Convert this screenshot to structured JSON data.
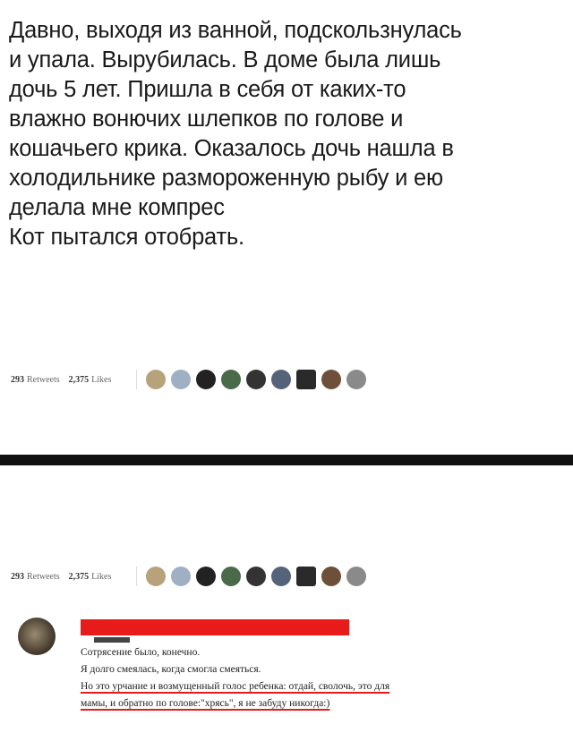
{
  "post": {
    "lines": [
      "Давно, выходя из ванной, подскользнулась",
      "и упала. Вырубилась. В доме была лишь",
      "дочь 5 лет. Пришла в себя от каких-то",
      "влажно вонючих шлепков по голове и",
      "кошачьего крика. Оказалось дочь нашла в",
      "холодильнике размороженную рыбу и ею",
      "делала мне компрес",
      "Кот пытался отобрать."
    ]
  },
  "stats": {
    "retweets_count": "293",
    "retweets_label": "Retweets",
    "likes_count": "2,375",
    "likes_label": "Likes"
  },
  "reply": {
    "lines": [
      "Сотрясение было, конечно.",
      "Я долго смеялась, когда смогла смеяться.",
      "Но это урчание и возмущенный голос ребенка: отдай, сволочь, это для",
      "мамы, и обратно по голове:\"хрясь\", я не забуду никогда:)"
    ]
  },
  "colors": {
    "redaction": "#e81b1b",
    "divider": "#111111"
  }
}
